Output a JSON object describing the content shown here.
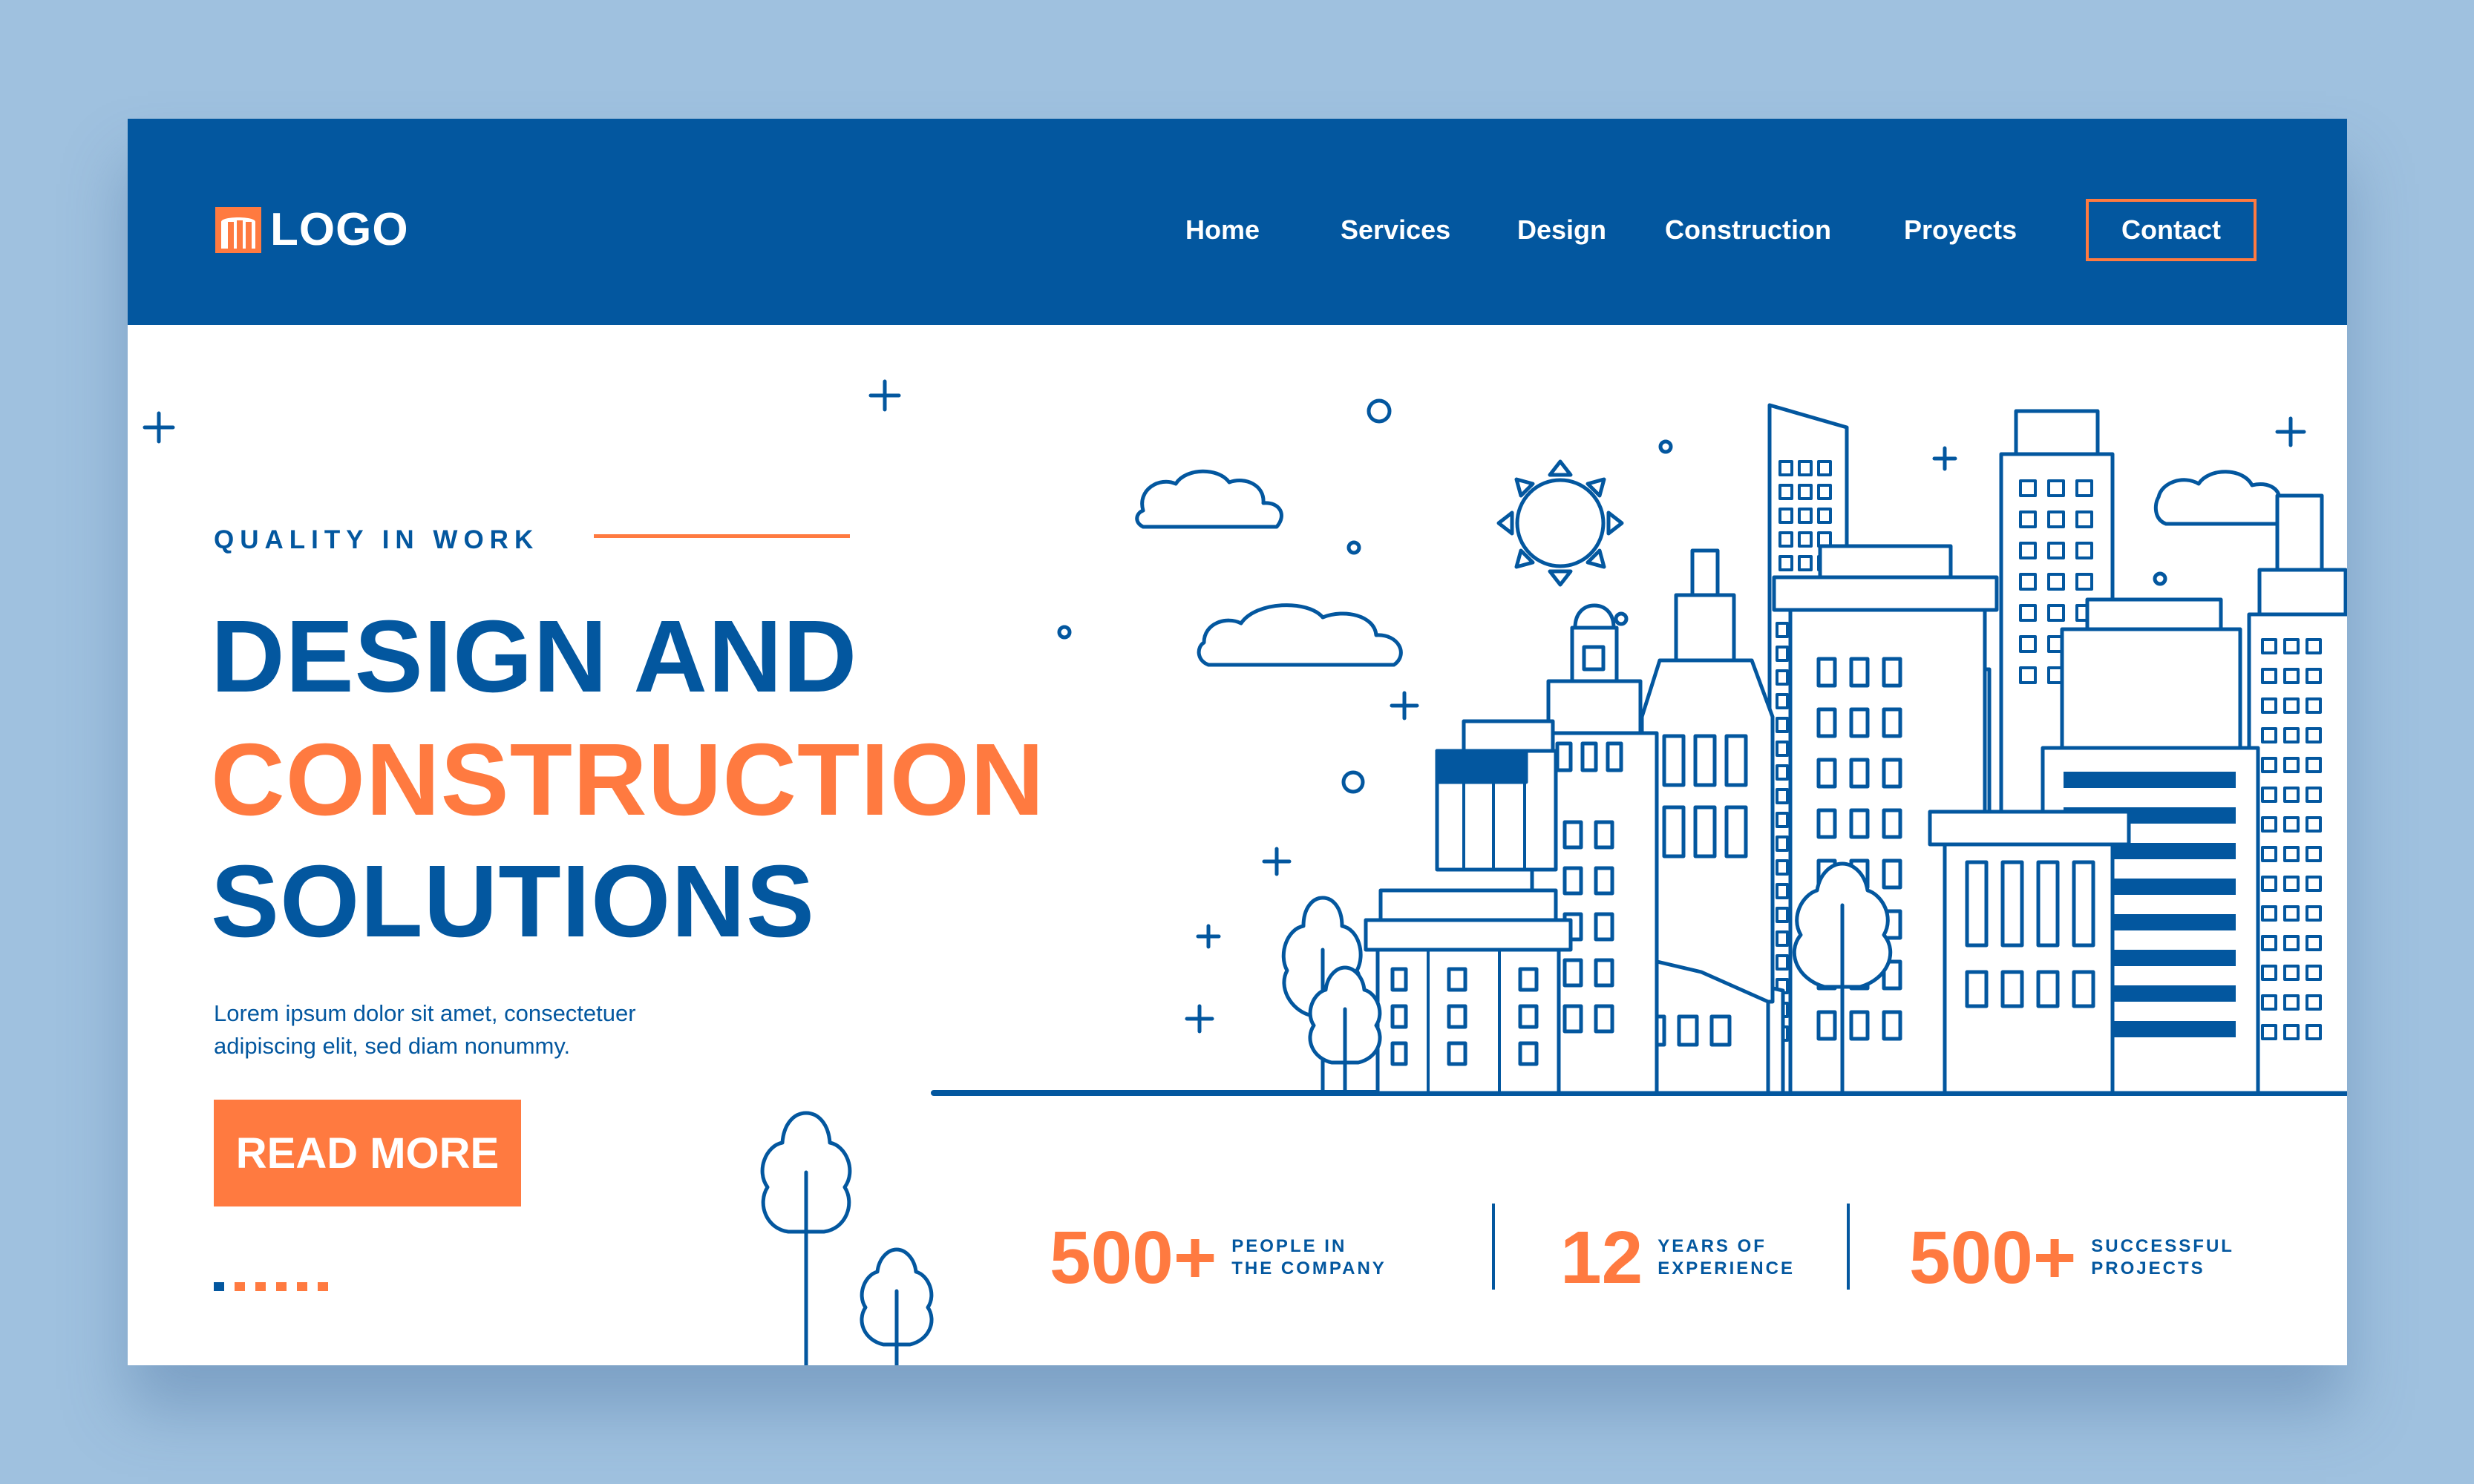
{
  "brand": {
    "logo_text": "LOGO"
  },
  "nav": {
    "items": [
      "Home",
      "Services",
      "Design",
      "Construction",
      "Proyects"
    ],
    "contact_label": "Contact"
  },
  "hero": {
    "eyebrow": "QUALITY IN WORK",
    "headline_lines": [
      "DESIGN AND",
      "CONSTRUCTION",
      "SOLUTIONS"
    ],
    "lead_lines": [
      "Lorem ipsum dolor sit amet, consectetuer",
      "adipiscing elit, sed diam nonummy."
    ],
    "cta_label": "READ MORE"
  },
  "stats": [
    {
      "value": "500+",
      "label_lines": [
        "PEOPLE IN",
        "THE COMPANY"
      ]
    },
    {
      "value": "12",
      "label_lines": [
        "YEARS OF",
        "EXPERIENCE"
      ]
    },
    {
      "value": "500+",
      "label_lines": [
        "SUCCESSFUL",
        "PROJECTS"
      ]
    }
  ],
  "colors": {
    "primary": "#03579f",
    "accent": "#ff7a40",
    "background": "#9fc1df",
    "card": "#ffffff"
  },
  "icons": [
    "logo-icon",
    "city-illustration",
    "tree-icon",
    "sun-icon",
    "cloud-icon",
    "sparkle-icon"
  ]
}
